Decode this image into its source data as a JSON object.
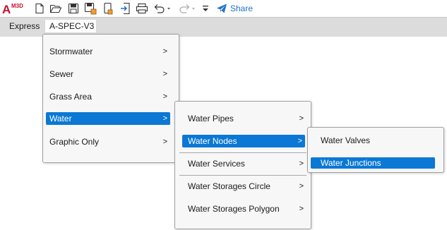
{
  "app": {
    "logo_text": "M3D",
    "logo_letter": "A"
  },
  "toolbar": {
    "icons": [
      "new-file-icon",
      "open-folder-icon",
      "save-icon",
      "save-as-icon",
      "publish-icon",
      "import-icon",
      "print-icon",
      "undo-icon",
      "redo-icon",
      "customize-dropdown-icon",
      "share-icon"
    ],
    "share_label": "Share"
  },
  "ribbon": {
    "label": "Express",
    "tab": "A-SPEC-V3"
  },
  "menu_level1": [
    {
      "label": "Stormwater",
      "arrow": ">"
    },
    {
      "label": "Sewer",
      "arrow": ">"
    },
    {
      "label": "Grass Area",
      "arrow": ">"
    },
    {
      "label": "Water",
      "arrow": ">",
      "selected": true
    },
    {
      "label": "Graphic Only",
      "arrow": ">"
    }
  ],
  "menu_level2": [
    {
      "label": "Water Pipes",
      "arrow": ">"
    },
    {
      "label": "Water Nodes",
      "arrow": ">",
      "selected": true
    },
    {
      "label": "Water Services",
      "arrow": ">"
    },
    {
      "label": "Water Storages Circle",
      "arrow": ">"
    },
    {
      "label": "Water Storages Polygon",
      "arrow": ">"
    }
  ],
  "menu_level3": [
    {
      "label": "Water Valves"
    },
    {
      "label": "Water Junctions",
      "selected": true
    }
  ],
  "colors": {
    "highlight": "#0a78d4",
    "share": "#1e72c8",
    "logo_red": "#c8102e",
    "ribbon_bg": "#dcdcdc"
  }
}
